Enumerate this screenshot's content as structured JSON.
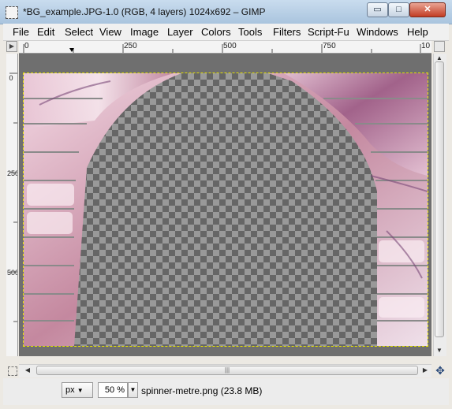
{
  "window": {
    "title": "*BG_example.JPG-1.0 (RGB, 4 layers) 1024x692 – GIMP",
    "minimize_glyph": "▭",
    "maximize_glyph": "□",
    "close_glyph": "✕"
  },
  "menu": [
    {
      "label": "File"
    },
    {
      "label": "Edit"
    },
    {
      "label": "Select"
    },
    {
      "label": "View"
    },
    {
      "label": "Image"
    },
    {
      "label": "Layer"
    },
    {
      "label": "Colors"
    },
    {
      "label": "Tools"
    },
    {
      "label": "Filters"
    },
    {
      "label": "Script-Fu"
    },
    {
      "label": "Windows"
    },
    {
      "label": "Help"
    }
  ],
  "ruler": {
    "corner_glyph": "▶",
    "h_ticks": [
      "0",
      "250",
      "500",
      "750",
      "10"
    ],
    "v_ticks": [
      "0",
      "250",
      "500"
    ]
  },
  "scroll": {
    "h_grip": "|||",
    "nav_glyph": "✥"
  },
  "status": {
    "unit": "px",
    "zoom": "50 %",
    "message": "spinner-metre.png (23.8 MB)"
  }
}
